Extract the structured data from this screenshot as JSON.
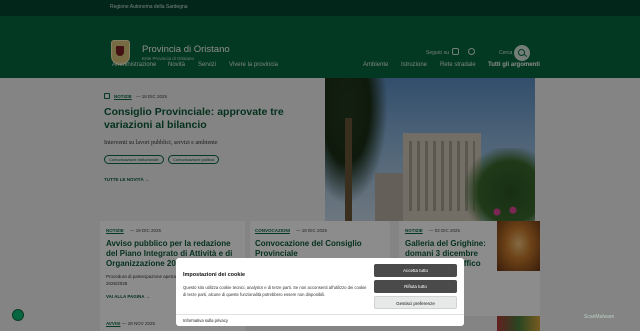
{
  "topbar": {
    "region": "Regione Autonoma della Sardegna"
  },
  "brand": {
    "title": "Provincia di Oristano",
    "subtitle": "Ente Provincia di Oristano"
  },
  "header": {
    "follow_label": "Seguici su",
    "search_label": "Cerca"
  },
  "nav": {
    "items": [
      "Amministrazione",
      "Novità",
      "Servizi",
      "Vivere la provincia"
    ],
    "right_items": [
      "Ambiente",
      "Istruzione",
      "Rete stradale"
    ],
    "all_topics": "Tutti gli argomenti"
  },
  "hero": {
    "category": "NOTIZIE",
    "date": "— 18 DIC 2025",
    "title": "Consiglio Provinciale: approvate tre variazioni al bilancio",
    "subtitle": "Interventi su lavori pubblici, servizi e ambiente",
    "tags": [
      "Comunicazione istituzionale",
      "Comunicazione politica"
    ],
    "all_news": "TUTTE LE NOVITÀ →"
  },
  "cards": [
    {
      "category": "NOTIZIE",
      "date": "— 19 DIC 2025",
      "title": "Avviso pubblico per la redazione del Piano Integrato di Attività e di Organizzazione 2026",
      "body": "Procedura di partecipazione aperta per l'aggiornamento del P.I.A.O. 2026/2028",
      "link": "VAI ALLA PAGINA →"
    },
    {
      "category": "CONVOCAZIONI",
      "date": "— 18 DIC 2025",
      "title": "Convocazione del Consiglio Provinciale"
    },
    {
      "category": "NOTIZIE",
      "date": "— 02 DIC 2025",
      "title": "Galleria del Grighine: domani 3 dicembre riapertura al traffico"
    }
  ],
  "card_row2": {
    "category": "AVVISI",
    "date": "— 28 NOV 2025"
  },
  "cookie": {
    "title": "Impostazioni dei cookie",
    "text": "Questo sito utilizza cookie tecnici, analytics e di terze parti. Se non acconsenti all'utilizzo dei cookie di terze parti, alcune di queste funzionalità potrebbero essere non disponibili.",
    "accept": "Accetta tutto",
    "reject": "Rifiuta tutto",
    "manage": "Gestisci preferenze",
    "privacy": "Informativa sulla privacy"
  },
  "watermark": "ScanMalware",
  "colors": {
    "primary": "#06663f",
    "dark": "#05462e",
    "accent": "#0a5a38"
  }
}
